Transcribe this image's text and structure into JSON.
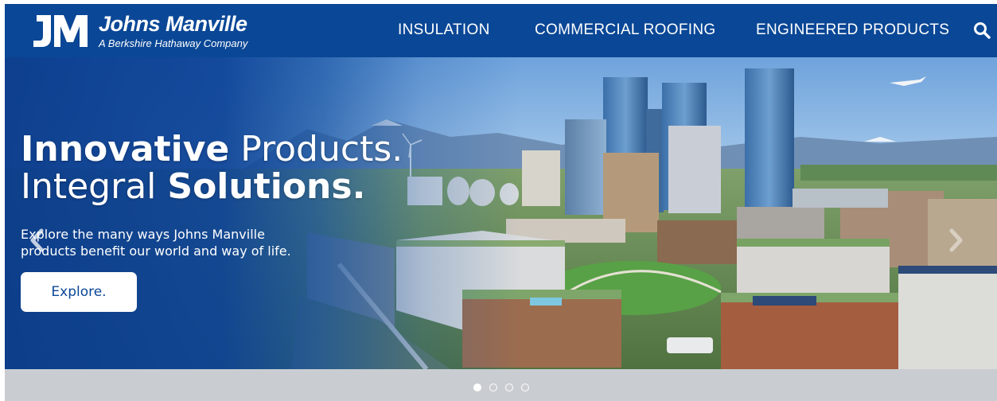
{
  "brand": {
    "monogram": "JM",
    "name": "Johns Manville",
    "tagline": "A Berkshire Hathaway Company",
    "color": "#0a4796"
  },
  "nav": {
    "items": [
      {
        "label": "INSULATION"
      },
      {
        "label": "COMMERCIAL ROOFING"
      },
      {
        "label": "ENGINEERED PRODUCTS"
      }
    ],
    "search_icon": "search-icon"
  },
  "hero": {
    "headline_line1_bold": "Innovative",
    "headline_line1_rest": " Products.",
    "headline_line2_light": "Integral ",
    "headline_line2_bold": "Solutions.",
    "subtext": "Explore the many ways Johns Manville products benefit our world and way of life.",
    "cta_label": "Explore.",
    "prev_icon": "chevron-left-icon",
    "next_icon": "chevron-right-icon"
  },
  "carousel": {
    "slide_count": 4,
    "active_index": 0
  }
}
